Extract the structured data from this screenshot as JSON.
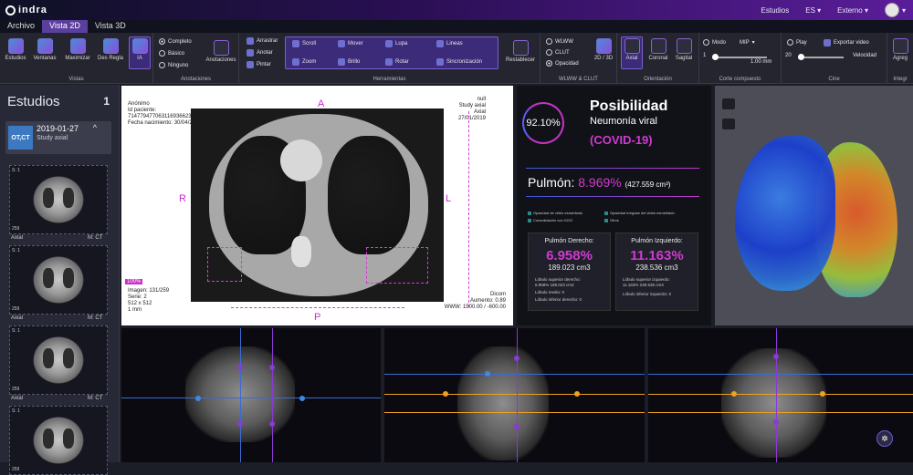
{
  "topbar": {
    "logo": "indra",
    "nav": [
      "Estudios",
      "ES",
      "Externo"
    ]
  },
  "tabs": [
    {
      "label": "Archivo"
    },
    {
      "label": "Vista 2D",
      "active": true
    },
    {
      "label": "Vista 3D"
    }
  ],
  "ribbon": {
    "vistas": {
      "group": "Vistas",
      "items": [
        "Estudios",
        "Ventanas",
        "Maximizar",
        "Des Regla",
        "IA"
      ]
    },
    "anotaciones": {
      "group": "Anotaciones",
      "options": [
        "Completo",
        "Básico",
        "Ninguno"
      ],
      "selected": "Completo",
      "button": "Anotaciones"
    },
    "herramientas": {
      "group": "Herramientas",
      "items": [
        "Arrastrar",
        "Anotar",
        "Pintar",
        "Scroll",
        "Zoom",
        "Mover",
        "Brillo",
        "Lupa",
        "Rotar",
        "Lineas",
        "Sincronización",
        "Restablecer"
      ]
    },
    "wlww": {
      "group": "WLWW & CLUT",
      "items": [
        "WLWW",
        "CLUT",
        "Opacidad"
      ],
      "button": "2D / 3D",
      "group2": "2D / 3D"
    },
    "orientacion": {
      "group": "Orientación",
      "items": [
        "Axial",
        "Coronal",
        "Sagital"
      ]
    },
    "corte": {
      "group": "Corte compuesto",
      "modo": "Modo",
      "mip": "MIP",
      "min": "1",
      "value": "1.00 mm"
    },
    "cine": {
      "group": "Cine",
      "play": "Play",
      "export": "Exportar video",
      "speed": "20",
      "speed_label": "Velocidad"
    },
    "extra": {
      "item": "Agreg",
      "group": "Integr"
    }
  },
  "sidebar": {
    "title": "Estudios",
    "count": "1",
    "study": {
      "badge": "OT,CT",
      "date": "2019-01-27",
      "desc": "Study axial"
    },
    "thumbs": [
      {
        "s": "S: 1",
        "n": "259",
        "left": "Axial",
        "right": "M: CT"
      },
      {
        "s": "S: 1",
        "n": "259",
        "left": "Axial",
        "right": "M: CT"
      },
      {
        "s": "S: 1",
        "n": "259",
        "left": "Axial",
        "right": "M: CT"
      },
      {
        "s": "S: 1",
        "n": "259",
        "left": "",
        "right": ""
      }
    ]
  },
  "viewer": {
    "info_tl": [
      "Anónimo",
      "Id paciente:",
      "714779477063116936623251",
      "Fecha nacimiento: 30/04/2013"
    ],
    "info_tr": [
      "null",
      "Study axial",
      "Axial",
      "27/01/2019"
    ],
    "info_bl": [
      "Imagen: 131/259",
      "Serie: 2",
      "512 x 512",
      "1 mm"
    ],
    "info_br": [
      "Dicom",
      "Aumento: 0.89",
      "WWW: 1500.00 / -600.00"
    ],
    "zoom_pct": "100%",
    "labels": {
      "a": "A",
      "p": "P",
      "r": "R",
      "l": "L"
    }
  },
  "ai": {
    "gauge": "92.10%",
    "title": "Posibilidad",
    "subtitle": "Neumonía viral",
    "covid": "(COVID-19)",
    "pulmon_label": "Pulmón: ",
    "pulmon_pct": "8.969%",
    "pulmon_vol": "(427.559 cm³)",
    "checks": [
      "Opacidad de vidrio esmerilado",
      "Opacidad irregular del vidrio esmerilado",
      "Consolidación con GGO",
      "Otros"
    ],
    "right": {
      "title": "Pulmón Derecho:",
      "pct": "6.958%",
      "vol": "189.023 cm3",
      "sup": "Lóbulo superior derecho:",
      "sup_v": "6.958% 189.023 cm3",
      "med": "Lóbulo medio: 0",
      "inf": "Lóbulo inferior derecho: 0"
    },
    "left": {
      "title": "Pulmón Izquierdo:",
      "pct": "11.163%",
      "vol": "238.536 cm3",
      "sup": "Lóbulo superior izquierdo:",
      "sup_v": "11.163% 238.536 cm3",
      "inf": "Lóbulo inferior izquierdo: 0"
    }
  },
  "icons": {
    "fab": "settings-gear-icon"
  },
  "colors": {
    "accent": "#5b3f9e",
    "magenta": "#d03ad0",
    "blue": "#3b5bd6",
    "orange": "#f0a020"
  }
}
